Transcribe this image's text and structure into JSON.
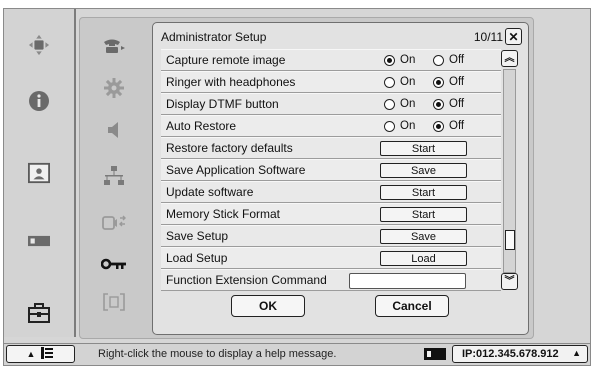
{
  "dialog": {
    "title": "Administrator Setup",
    "page": "10/11",
    "close_glyph": "✕"
  },
  "settings": [
    {
      "label": "Capture remote image",
      "type": "radio",
      "on_label": "On",
      "off_label": "Off",
      "selected": "On"
    },
    {
      "label": "Ringer with headphones",
      "type": "radio",
      "on_label": "On",
      "off_label": "Off",
      "selected": "Off"
    },
    {
      "label": "Display DTMF button",
      "type": "radio",
      "on_label": "On",
      "off_label": "Off",
      "selected": "Off"
    },
    {
      "label": "Auto Restore",
      "type": "radio",
      "on_label": "On",
      "off_label": "Off",
      "selected": "Off"
    },
    {
      "label": "Restore factory defaults",
      "type": "button",
      "button_label": "Start"
    },
    {
      "label": "Save Application Software",
      "type": "button",
      "button_label": "Save"
    },
    {
      "label": "Update software",
      "type": "button",
      "button_label": "Start"
    },
    {
      "label": "Memory Stick Format",
      "type": "button",
      "button_label": "Start"
    },
    {
      "label": "Save Setup",
      "type": "button",
      "button_label": "Save"
    },
    {
      "label": "Load Setup",
      "type": "button",
      "button_label": "Load"
    },
    {
      "label": "Function Extension Command",
      "type": "text",
      "value": ""
    }
  ],
  "footer": {
    "ok_label": "OK",
    "cancel_label": "Cancel"
  },
  "scrollbar": {
    "up_glyph": "︽",
    "down_glyph": "︾",
    "position": 0.88
  },
  "status": {
    "hint": "Right-click the mouse to display a help message.",
    "ip": "IP:012.345.678.912",
    "ip_arrow": "▲",
    "menu_arrow": "▲"
  },
  "leftnav_icons": [
    "move-cross-icon",
    "info-icon",
    "picture-icon",
    "card-icon",
    "toolbox-icon"
  ],
  "subnav_icons": [
    "phone-icon",
    "gear-icon",
    "speaker-icon",
    "network-icon",
    "camera-switch-icon",
    "key-icon",
    "bracket-icon"
  ],
  "colors": {
    "panel": "#c9c9c9",
    "dialog": "#e2e2e2",
    "frame": "#d3d3d3"
  }
}
